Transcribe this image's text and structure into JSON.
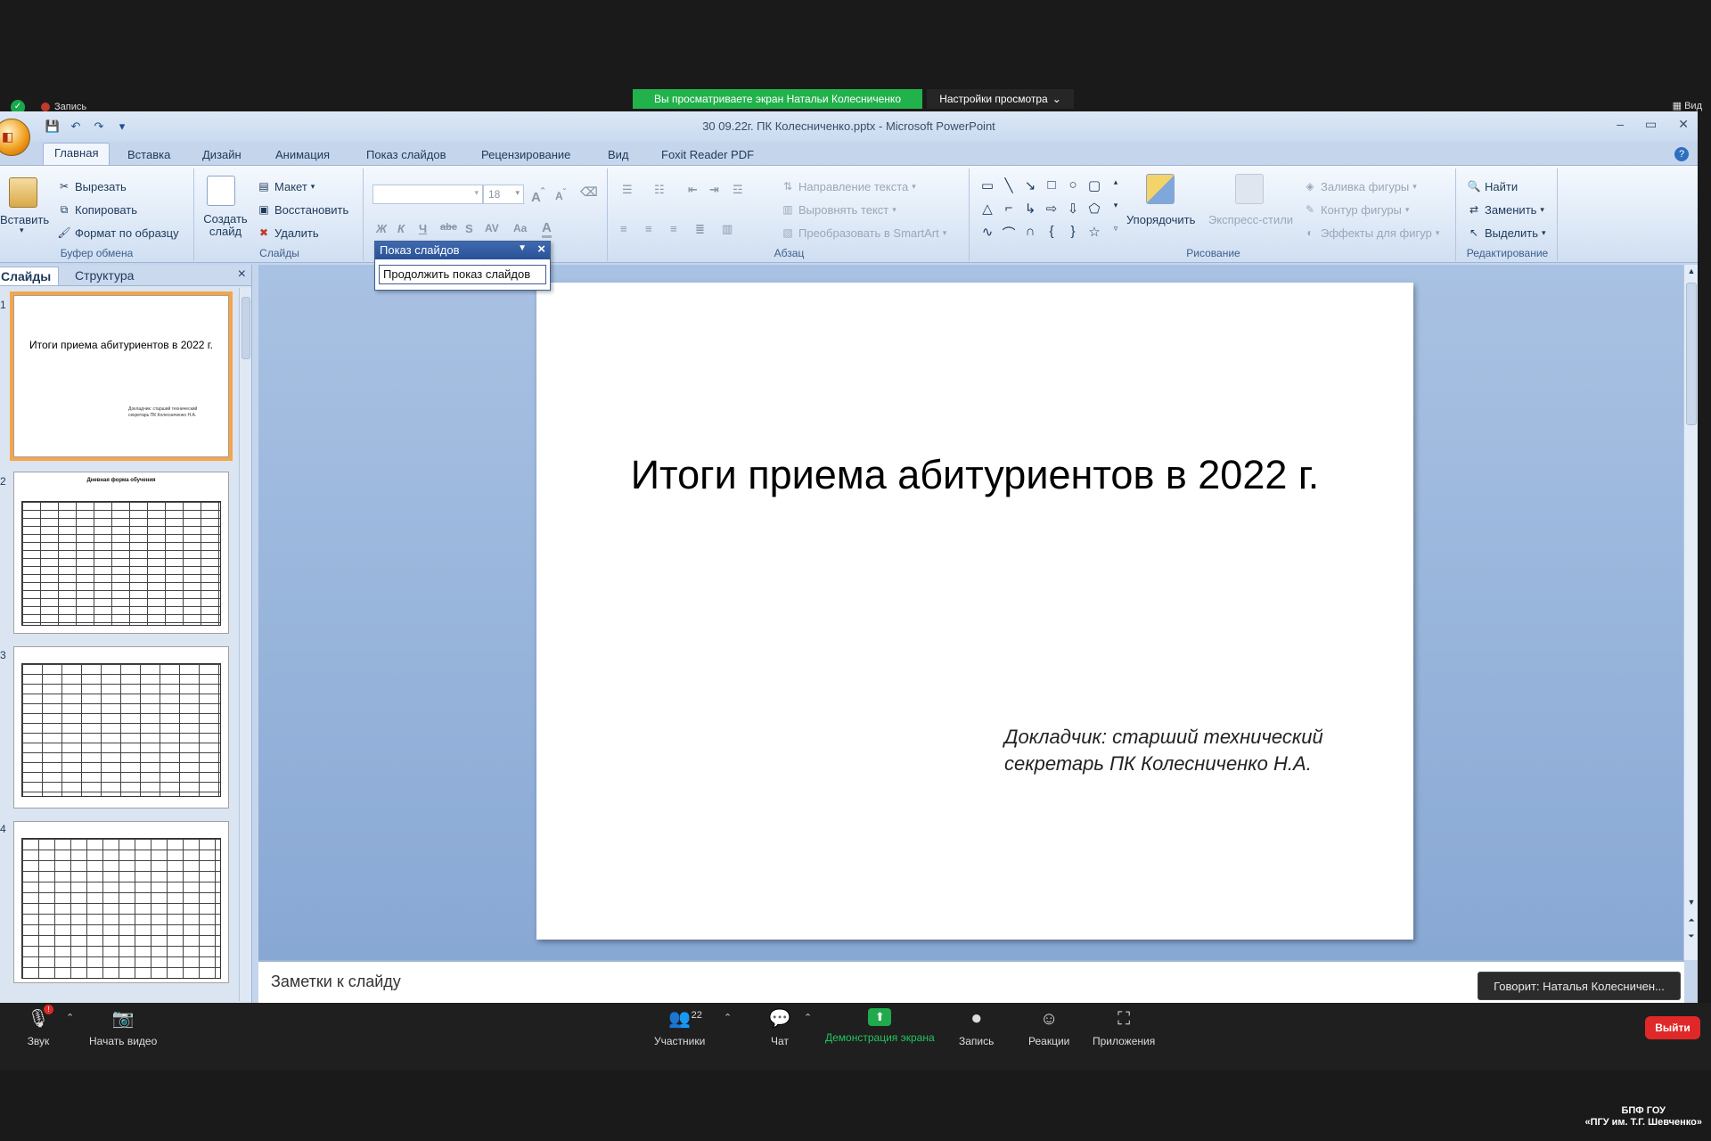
{
  "zoom": {
    "viewing_banner": "Вы просматриваете экран Натальи Колесниченко",
    "view_settings": "Настройки просмотра",
    "recording_label": "Запись",
    "view_label": "Вид",
    "speaking": "Говорит: Наталья Колесничен...",
    "toolbar": {
      "audio": "Звук",
      "video": "Начать видео",
      "participants": "Участники",
      "participants_count": "22",
      "chat": "Чат",
      "share": "Демонстрация экрана",
      "record": "Запись",
      "reactions": "Реакции",
      "apps": "Приложения",
      "leave": "Выйти"
    },
    "watermark_line1": "БПФ ГОУ",
    "watermark_line2": "«ПГУ им. Т.Г. Шевченко»"
  },
  "ppt": {
    "window_title": "30 09.22г. ПК Колесниченко.pptx - Microsoft PowerPoint",
    "tabs": [
      "Главная",
      "Вставка",
      "Дизайн",
      "Анимация",
      "Показ слайдов",
      "Рецензирование",
      "Вид",
      "Foxit Reader PDF"
    ],
    "clipboard": {
      "paste": "Вставить",
      "cut": "Вырезать",
      "copy": "Копировать",
      "format_painter": "Формат по образцу",
      "label": "Буфер обмена"
    },
    "slides_group": {
      "new_slide": "Создать слайд",
      "layout": "Макет",
      "reset": "Восстановить",
      "delete": "Удалить",
      "label": "Слайды"
    },
    "font": {
      "size": "18"
    },
    "paragraph": {
      "text_direction": "Направление текста",
      "align_text": "Выровнять текст",
      "smartart": "Преобразовать в SmartArt",
      "label": "Абзац"
    },
    "drawing": {
      "arrange": "Упорядочить",
      "quick_styles": "Экспресс-стили",
      "shape_fill": "Заливка фигуры",
      "shape_outline": "Контур фигуры",
      "shape_effects": "Эффекты для фигур",
      "label": "Рисование"
    },
    "editing": {
      "find": "Найти",
      "replace": "Заменить",
      "select": "Выделить",
      "label": "Редактирование"
    },
    "panel_tabs": [
      "Слайды",
      "Структура"
    ],
    "thumbnail1": {
      "title": "Итоги приема абитуриентов в 2022 г.",
      "sub": "Докладчик: старший технический секретарь ПК Колесниченко Н.А."
    },
    "thumbnail2_title": "Дневная форма обучения",
    "slideshow_popup": {
      "title": "Показ слайдов",
      "item": "Продолжить показ слайдов"
    },
    "slide": {
      "title": "Итоги приема абитуриентов в 2022 г.",
      "subtitle_line1": "Докладчик: старший технический",
      "subtitle_line2": "секретарь ПК Колесниченко Н.А."
    },
    "notes_placeholder": "Заметки к слайду"
  }
}
